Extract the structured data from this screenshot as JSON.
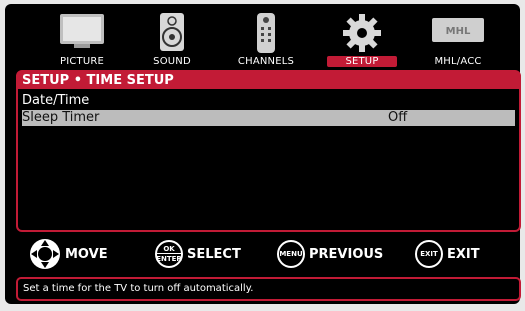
{
  "tabs": [
    {
      "label": "PICTURE",
      "icon": "tv-icon"
    },
    {
      "label": "SOUND",
      "icon": "speaker-icon"
    },
    {
      "label": "CHANNELS",
      "icon": "remote-icon"
    },
    {
      "label": "SETUP",
      "icon": "gear-icon"
    },
    {
      "label": "MHL/ACC",
      "icon": "mhl-logo-icon"
    }
  ],
  "mhl_logo_text": "MHL",
  "panel": {
    "title": "SETUP • TIME SETUP",
    "rows": [
      {
        "label": "Date/Time",
        "value": ""
      },
      {
        "label": "Sleep Timer",
        "value": "Off"
      }
    ]
  },
  "controls": {
    "move": "MOVE",
    "ok_top": "OK",
    "ok_bottom": "ENTER",
    "select": "SELECT",
    "menu_btn": "MENU",
    "previous": "PREVIOUS",
    "exit_btn": "EXIT",
    "exit": "EXIT"
  },
  "help_text": "Set a time for the TV to turn off automatically.",
  "colors": {
    "accent": "#c21b36",
    "highlight": "#bcbcbc"
  }
}
